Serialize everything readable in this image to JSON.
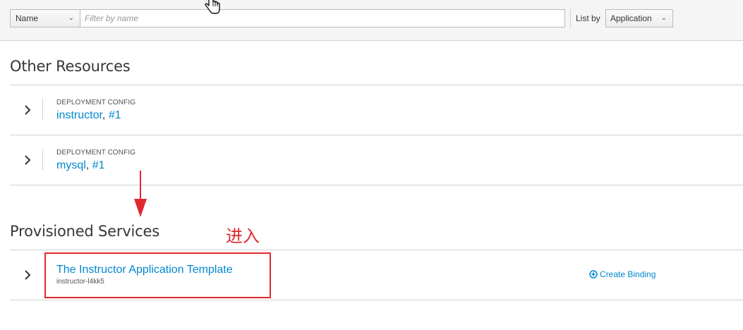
{
  "toolbar": {
    "filter_field_selected": "Name",
    "filter_placeholder": "Filter by name",
    "list_by_label": "List by",
    "list_by_selected": "Application"
  },
  "other_resources": {
    "title": "Other Resources",
    "items": [
      {
        "kind": "DEPLOYMENT CONFIG",
        "name": "instructor",
        "separator": ", ",
        "revision": "#1"
      },
      {
        "kind": "DEPLOYMENT CONFIG",
        "name": "mysql",
        "separator": ", ",
        "revision": "#1"
      }
    ]
  },
  "provisioned_services": {
    "title": "Provisioned Services",
    "items": [
      {
        "name": "The Instructor Application Template",
        "id": "instructor-l4kk5",
        "action_label": "Create Binding"
      }
    ]
  },
  "annotation": {
    "text": "进入",
    "color": "#e0282e"
  },
  "colors": {
    "link": "#0088ce",
    "annotation_red": "#e0282e",
    "toolbar_bg": "#f5f5f5"
  },
  "icons": {
    "caret": "chevron-down-icon",
    "expand": "chevron-right-icon",
    "add": "plus-circle-icon",
    "cursor": "hand-pointer-icon"
  }
}
